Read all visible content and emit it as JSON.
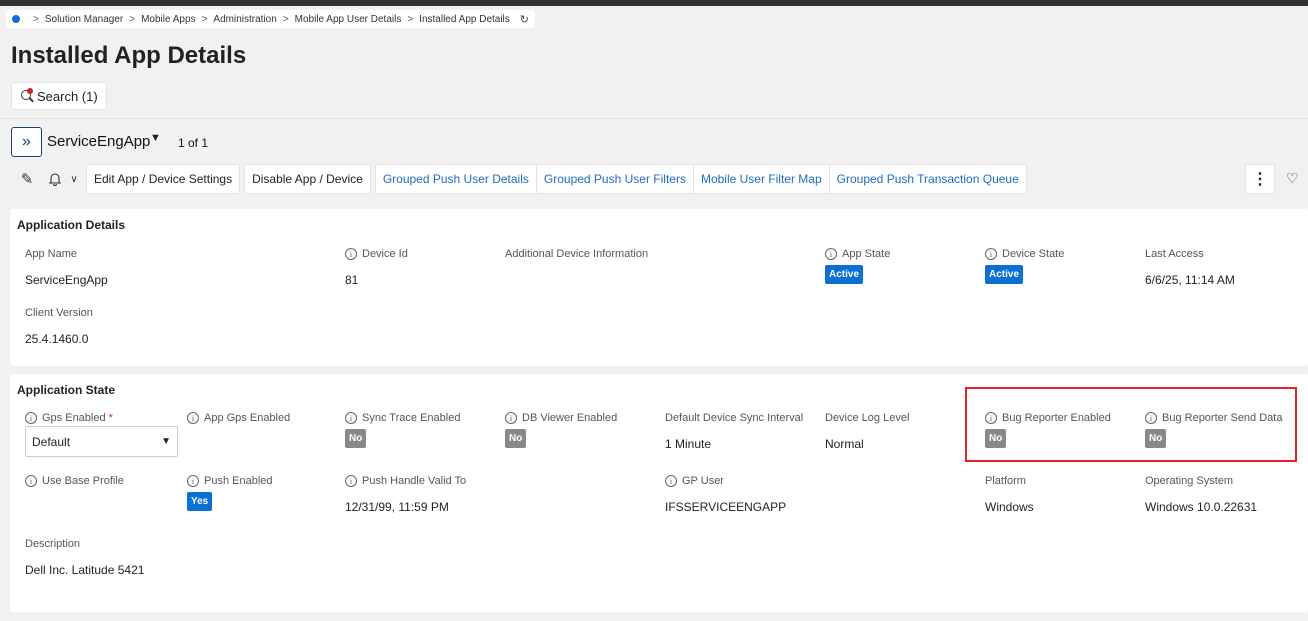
{
  "breadcrumb": {
    "items": [
      "Solution Manager",
      "Mobile Apps",
      "Administration",
      "Mobile App User Details",
      "Installed App Details"
    ],
    "separator": ">"
  },
  "page_title": "Installed App Details",
  "search": {
    "label": "Search (1)"
  },
  "record": {
    "name": "ServiceEngApp",
    "count": "1 of 1"
  },
  "toolbar": {
    "edit_label": "Edit App / Device Settings",
    "disable_label": "Disable App / Device",
    "links": [
      "Grouped Push User Details",
      "Grouped Push User Filters",
      "Mobile User Filter Map",
      "Grouped Push Transaction Queue"
    ]
  },
  "application_details": {
    "title": "Application Details",
    "app_name": {
      "label": "App Name",
      "value": "ServiceEngApp"
    },
    "device_id": {
      "label": "Device Id",
      "value": "81"
    },
    "additional_info": {
      "label": "Additional Device Information",
      "value": ""
    },
    "app_state": {
      "label": "App State",
      "value": "Active"
    },
    "device_state": {
      "label": "Device State",
      "value": "Active"
    },
    "last_access": {
      "label": "Last Access",
      "value": "6/6/25, 11:14 AM"
    },
    "client_version": {
      "label": "Client Version",
      "value": "25.4.1460.0"
    }
  },
  "application_state": {
    "title": "Application State",
    "gps_enabled": {
      "label": "Gps Enabled",
      "required": "*",
      "value": "Default"
    },
    "app_gps_enabled": {
      "label": "App Gps Enabled",
      "value": ""
    },
    "sync_trace_enabled": {
      "label": "Sync Trace Enabled",
      "value": "No"
    },
    "db_viewer_enabled": {
      "label": "DB Viewer Enabled",
      "value": "No"
    },
    "default_sync_interval": {
      "label": "Default Device Sync Interval",
      "value": "1 Minute"
    },
    "device_log_level": {
      "label": "Device Log Level",
      "value": "Normal"
    },
    "bug_reporter_enabled": {
      "label": "Bug Reporter Enabled",
      "value": "No"
    },
    "bug_reporter_send_data": {
      "label": "Bug Reporter Send Data",
      "value": "No"
    },
    "use_base_profile": {
      "label": "Use Base Profile",
      "value": ""
    },
    "push_enabled": {
      "label": "Push Enabled",
      "value": "Yes"
    },
    "push_handle_valid_to": {
      "label": "Push Handle Valid To",
      "value": "12/31/99, 11:59 PM"
    },
    "gp_user": {
      "label": "GP User",
      "value": "IFSSERVICEENGAPP"
    },
    "platform": {
      "label": "Platform",
      "value": "Windows"
    },
    "operating_system": {
      "label": "Operating System",
      "value": "Windows 10.0.22631"
    },
    "description": {
      "label": "Description",
      "value": "Dell Inc. Latitude 5421"
    }
  },
  "colors": {
    "accent": "#0b6fd3",
    "link": "#1d6bc4",
    "highlight": "#e3222b",
    "badge_gray": "#888888"
  }
}
